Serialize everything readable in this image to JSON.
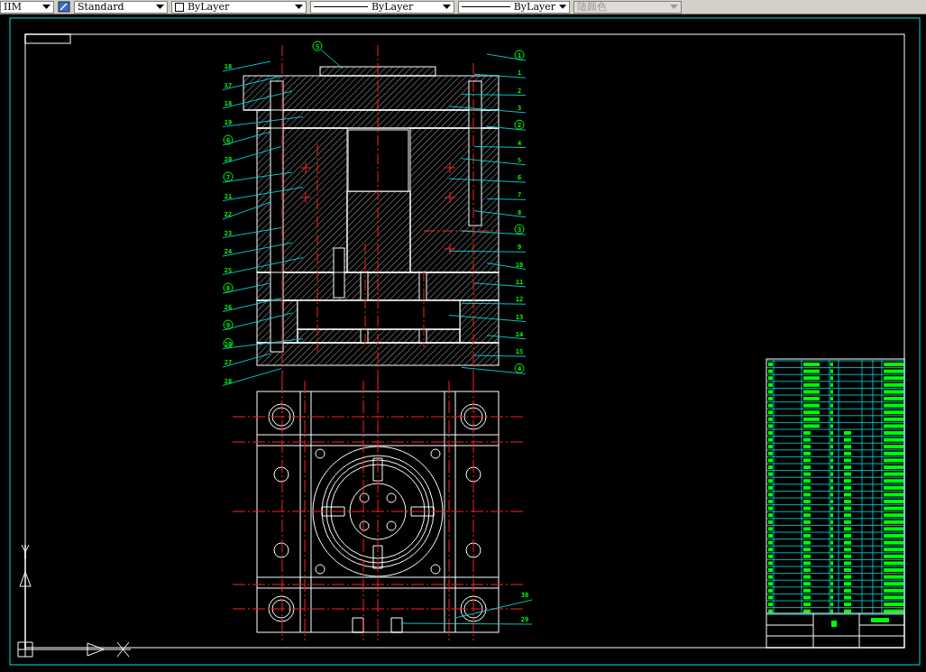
{
  "toolbar": [
    {
      "kind": "dropdown",
      "value": "IIM",
      "disabled": false
    },
    {
      "kind": "icon"
    },
    {
      "kind": "dropdown",
      "value": "Standard",
      "disabled": false
    },
    {
      "kind": "swatch",
      "value": "ByLayer",
      "disabled": false
    },
    {
      "kind": "linetype",
      "value": "ByLayer",
      "disabled": false
    },
    {
      "kind": "linetype",
      "value": "ByLayer",
      "disabled": false
    },
    {
      "kind": "dropdown",
      "value": "随颜色",
      "disabled": true
    }
  ],
  "drawing": {
    "top_labels": [
      {
        "text": "5",
        "circled": true
      }
    ],
    "left_labels": [
      {
        "text": "18",
        "circled": false
      },
      {
        "text": "17",
        "circled": false
      },
      {
        "text": "18",
        "circled": false
      },
      {
        "text": "19",
        "circled": false
      },
      {
        "text": "6",
        "circled": true
      },
      {
        "text": "20",
        "circled": false
      },
      {
        "text": "7",
        "circled": true
      },
      {
        "text": "21",
        "circled": false
      },
      {
        "text": "22",
        "circled": false
      },
      {
        "text": "23",
        "circled": false
      },
      {
        "text": "24",
        "circled": false
      },
      {
        "text": "25",
        "circled": false
      },
      {
        "text": "8",
        "circled": true
      },
      {
        "text": "26",
        "circled": false
      },
      {
        "text": "9",
        "circled": true
      },
      {
        "text": "10",
        "circled": true
      },
      {
        "text": "27",
        "circled": false
      },
      {
        "text": "28",
        "circled": false
      }
    ],
    "right_labels": [
      {
        "text": "1",
        "circled": true
      },
      {
        "text": "1",
        "circled": false
      },
      {
        "text": "2",
        "circled": false
      },
      {
        "text": "3",
        "circled": false
      },
      {
        "text": "2",
        "circled": true
      },
      {
        "text": "4",
        "circled": false
      },
      {
        "text": "5",
        "circled": false
      },
      {
        "text": "6",
        "circled": false
      },
      {
        "text": "7",
        "circled": false
      },
      {
        "text": "8",
        "circled": false
      },
      {
        "text": "3",
        "circled": true
      },
      {
        "text": "9",
        "circled": false
      },
      {
        "text": "10",
        "circled": false
      },
      {
        "text": "11",
        "circled": false
      },
      {
        "text": "12",
        "circled": false
      },
      {
        "text": "13",
        "circled": false
      },
      {
        "text": "14",
        "circled": false
      },
      {
        "text": "15",
        "circled": false
      },
      {
        "text": "4",
        "circled": true
      }
    ],
    "bottom_labels": [
      {
        "text": "30",
        "circled": false
      },
      {
        "text": "29",
        "circled": false
      }
    ]
  }
}
